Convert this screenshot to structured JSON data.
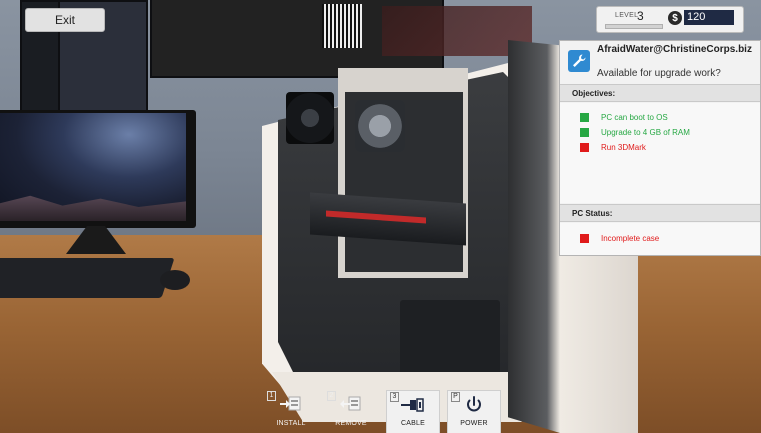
{
  "hud": {
    "exit_label": "Exit",
    "level_label": "LEVEL",
    "level_value": "3",
    "xp_progress": 0.0,
    "money_symbol": "$",
    "money_value": "120"
  },
  "email": {
    "icon": "wrench-icon",
    "from": "AfraidWater@ChristineCorps.biz",
    "subject": "Available for upgrade work?"
  },
  "objectives": {
    "header": "Objectives:",
    "items": [
      {
        "text": "PC can boot to OS",
        "status": "done",
        "color": "#27a844"
      },
      {
        "text": "Upgrade to 4 GB of RAM",
        "status": "done",
        "color": "#27a844"
      },
      {
        "text": "Run 3DMark",
        "status": "pending",
        "color": "#e01b1b"
      }
    ]
  },
  "pc_status": {
    "header": "PC Status:",
    "items": [
      {
        "text": "Incomplete case",
        "color": "#e01b1b"
      }
    ]
  },
  "toolbar": [
    {
      "key": "1",
      "label": "INSTALL",
      "icon": "install-icon",
      "active": false
    },
    {
      "key": "2",
      "label": "REMOVE",
      "icon": "remove-icon",
      "active": false
    },
    {
      "key": "3",
      "label": "CABLE",
      "icon": "cable-icon",
      "active": true
    },
    {
      "key": "P",
      "label": "POWER",
      "icon": "power-icon",
      "active": true
    }
  ],
  "colors": {
    "done": "#27a844",
    "failed": "#e01b1b",
    "accent": "#2f8ad1"
  }
}
